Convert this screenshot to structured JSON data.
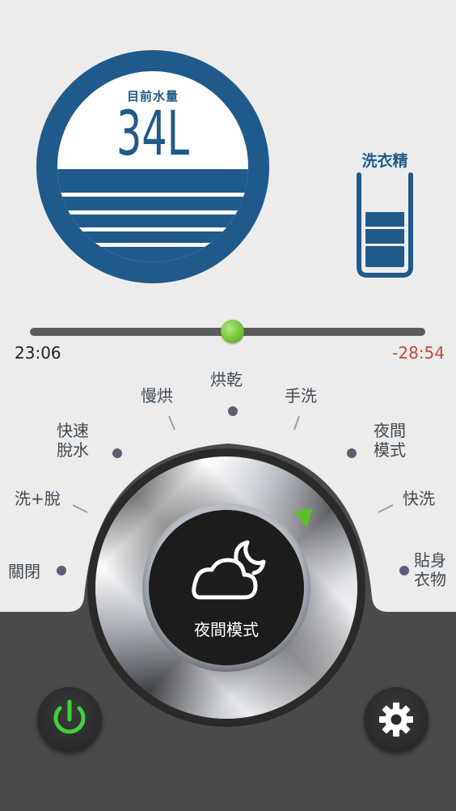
{
  "water": {
    "label": "目前水量",
    "value": "34L",
    "level": 0.42,
    "color": "#1f5a8a"
  },
  "detergent": {
    "label": "洗衣精",
    "level": 0.5,
    "color": "#1f5a8a"
  },
  "progress": {
    "elapsed": "23:06",
    "remaining": "-28:54",
    "fraction": 0.5,
    "knob_color": "#7ccc3c",
    "remaining_color": "#c04a38"
  },
  "modes": {
    "off": "關閉",
    "wash_spin": "洗+脫",
    "quick_spin": "快速\n脫水",
    "slow_dry": "慢烘",
    "dry": "烘乾",
    "hand_wash": "手洗",
    "night": "夜間\n模式",
    "quick_wash": "快洗",
    "delicates": "貼身\n衣物"
  },
  "dial": {
    "current_mode": "夜間模式",
    "icon": "cloud-moon-icon",
    "indicator_color": "#5bbf2c"
  },
  "buttons": {
    "power_icon": "power-icon",
    "power_color": "#3fd23a",
    "settings_icon": "gear-icon"
  }
}
